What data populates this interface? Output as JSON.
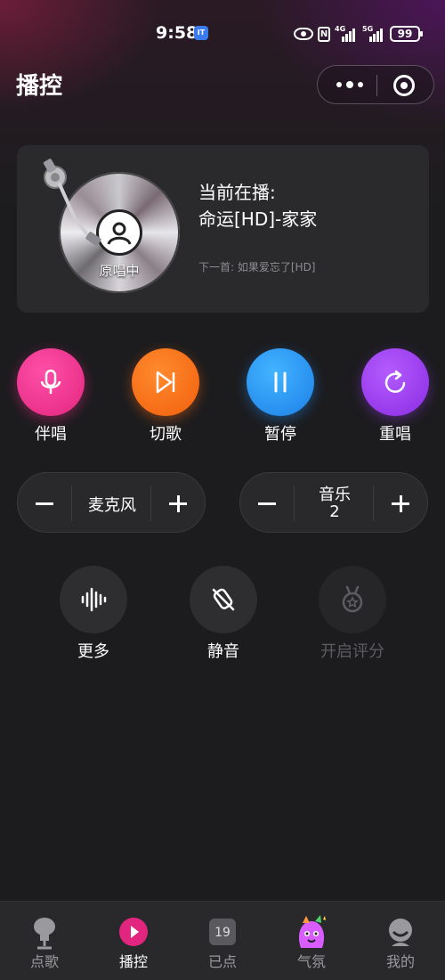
{
  "status_bar": {
    "time": "9:58",
    "app_badge": "IT",
    "network_1": "4G",
    "network_2": "5G",
    "battery": "99"
  },
  "header": {
    "title": "播控"
  },
  "now_playing": {
    "label": "当前在播:",
    "song": "命运[HD]-家家",
    "disc_label": "原唱中",
    "next": "下一首: 如果爱忘了[HD]"
  },
  "actions": [
    {
      "label": "伴唱",
      "icon": "microphone-icon",
      "color": "#e2267f"
    },
    {
      "label": "切歌",
      "icon": "skip-next-icon",
      "color": "#f15f0c"
    },
    {
      "label": "暂停",
      "icon": "pause-icon",
      "color": "#1d7fe8"
    },
    {
      "label": "重唱",
      "icon": "replay-icon",
      "color": "#8a2be2"
    }
  ],
  "volume": {
    "mic_label": "麦克风",
    "music_label": "音乐",
    "music_value": "2"
  },
  "tools": [
    {
      "label": "更多",
      "icon": "waveform-icon",
      "enabled": true
    },
    {
      "label": "静音",
      "icon": "mute-icon",
      "enabled": true
    },
    {
      "label": "开启评分",
      "icon": "medal-icon",
      "enabled": false
    }
  ],
  "tabbar": {
    "items": [
      {
        "label": "点歌",
        "icon": "mic-stand-icon"
      },
      {
        "label": "播控",
        "icon": "play-circle-icon",
        "active": true
      },
      {
        "label": "已点",
        "icon": "calendar-count-icon",
        "badge": "19"
      },
      {
        "label": "气氛",
        "icon": "party-mascot-icon"
      },
      {
        "label": "我的",
        "icon": "profile-face-icon"
      }
    ]
  },
  "colors": {
    "background": "#1c1c1e",
    "card": "#2a2a2c",
    "accent_pink": "#e2267f"
  }
}
